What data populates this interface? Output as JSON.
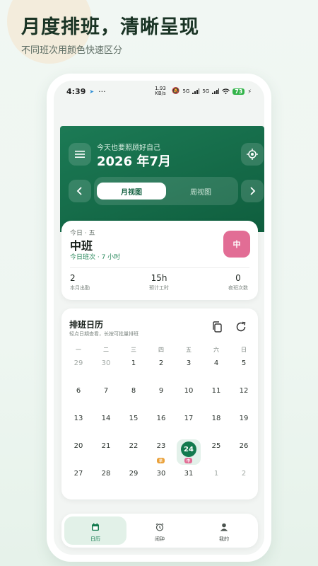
{
  "promo": {
    "title": "月度排班，清晰呈现",
    "subtitle": "不同班次用颜色快速区分"
  },
  "status_bar": {
    "time": "4:39",
    "dots": "···",
    "net_speed": "1.93 KB/s",
    "signal1": "5G",
    "signal2": "5G",
    "battery": "73"
  },
  "header": {
    "greeting": "今天也要照顾好自己",
    "month": "2026 年7月",
    "menu_icon": "menu-icon",
    "locate_icon": "locate-icon",
    "tabs": [
      "月视图",
      "周视图"
    ],
    "active_tab": 0,
    "accent": "#137a4e"
  },
  "today_card": {
    "label": "今日 · 五",
    "shift": "中班",
    "sub": "今日班次 · 7 小时",
    "badge": "中",
    "badge_color": "#e26d95",
    "stats": [
      {
        "value": "2",
        "label": "本月出勤"
      },
      {
        "value": "15h",
        "label": "预计工时"
      },
      {
        "value": "0",
        "label": "夜班次数"
      }
    ]
  },
  "calendar": {
    "title": "排班日历",
    "hint": "轻点日期查看，长按可批量排班",
    "copy_icon": "copy-icon",
    "refresh_icon": "refresh-icon",
    "weekdays": [
      "一",
      "二",
      "三",
      "四",
      "五",
      "六",
      "日"
    ],
    "rows": [
      [
        "29",
        "30",
        "1",
        "2",
        "3",
        "4",
        "5"
      ],
      [
        "6",
        "7",
        "8",
        "9",
        "10",
        "11",
        "12"
      ],
      [
        "13",
        "14",
        "15",
        "16",
        "17",
        "18",
        "19"
      ],
      [
        "20",
        "21",
        "22",
        "23",
        "24",
        "25",
        "26"
      ],
      [
        "27",
        "28",
        "29",
        "30",
        "31",
        "1",
        "2"
      ]
    ],
    "today": "24",
    "tags": [
      {
        "day": "23",
        "text": "早",
        "color": "#eaa23c"
      },
      {
        "day": "24",
        "text": "中",
        "color": "#e26d95"
      }
    ]
  },
  "bottom_nav": {
    "items": [
      {
        "label": "日历",
        "icon": "calendar-icon"
      },
      {
        "label": "闹钟",
        "icon": "alarm-icon"
      },
      {
        "label": "我的",
        "icon": "user-icon"
      }
    ],
    "active": 0
  }
}
